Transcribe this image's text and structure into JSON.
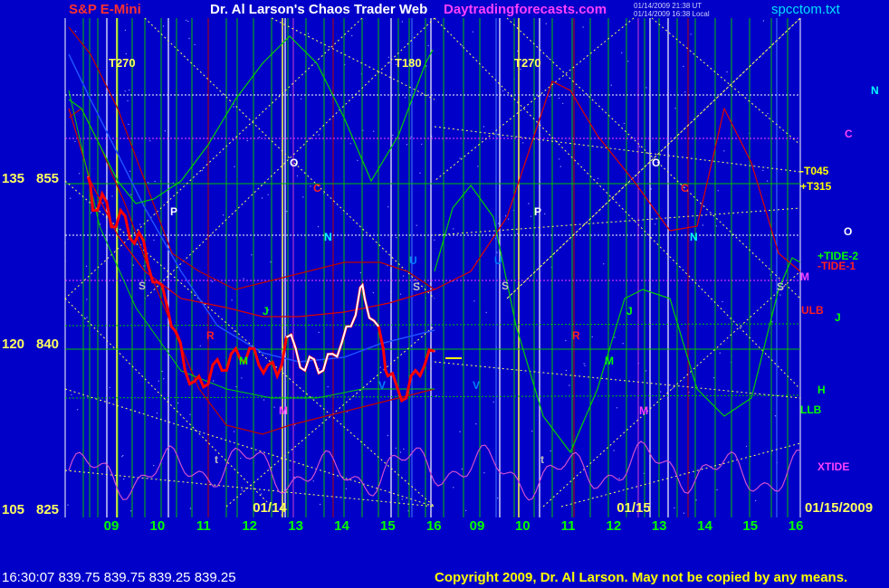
{
  "header": {
    "symbol": "S&P E-Mini",
    "title": "Dr. Al Larson's Chaos Trader Web",
    "site": "Daytradingforecasts.com",
    "stamp1": "01/14/2009 21:38 UT",
    "stamp2": "01/14/2009 16:38 Local",
    "file": "spcctom.txt"
  },
  "footer": {
    "quote": "16:30:07  839.75 839.75 839.25 839.25",
    "copyright": "Copyright 2009, Dr. Al Larson. May not be copied by any means."
  },
  "colors": {
    "background": "#0000c8",
    "green_lines": "#00d000",
    "price_red": "#ff0000",
    "price_white": "#ffffff",
    "grid_yellow": "#ffff60",
    "xtide": "#d050d0"
  },
  "chart_data": {
    "type": "line",
    "y_axis_left": {
      "ticks": [
        {
          "outer": "135",
          "inner": "855",
          "value": 855
        },
        {
          "outer": "120",
          "inner": "840",
          "value": 840
        },
        {
          "outer": "105",
          "inner": "825",
          "value": 825
        }
      ],
      "ylim": [
        825,
        859
      ]
    },
    "x_axis": {
      "hour_labels": [
        "09",
        "10",
        "11",
        "12",
        "13",
        "14",
        "15",
        "16",
        "09",
        "10",
        "11",
        "12",
        "13",
        "14",
        "15",
        "16"
      ],
      "date_labels": [
        "01/14",
        "01/15"
      ],
      "end_date": "01/15/2009"
    },
    "cycle_labels": [
      "T270",
      "T180",
      "T270"
    ],
    "right_labels": [
      {
        "text": "N",
        "color": "#00ffff"
      },
      {
        "text": "C",
        "color": "#ff40ff"
      },
      {
        "text": "-T045",
        "color": "#ffff00"
      },
      {
        "text": "+T315",
        "color": "#ffff00"
      },
      {
        "text": "O",
        "color": "#ffffff"
      },
      {
        "text": "+TIDE-2",
        "color": "#00ff00"
      },
      {
        "text": "-TIDE-1",
        "color": "#ff2020"
      },
      {
        "text": "M",
        "color": "#ff40ff"
      },
      {
        "text": "ULB",
        "color": "#ff2020"
      },
      {
        "text": "J",
        "color": "#00ff00"
      },
      {
        "text": "H",
        "color": "#00ff00"
      },
      {
        "text": "LLB",
        "color": "#00ff00"
      },
      {
        "text": "XTIDE",
        "color": "#ff40ff"
      }
    ],
    "planet_labels": [
      {
        "text": "P",
        "color": "#ffffff"
      },
      {
        "text": "O",
        "color": "#ffffff"
      },
      {
        "text": "C",
        "color": "#ff2020"
      },
      {
        "text": "N",
        "color": "#00ffff"
      },
      {
        "text": "S",
        "color": "#c0c0c0"
      },
      {
        "text": "R",
        "color": "#ff2020"
      },
      {
        "text": "J",
        "color": "#00ff00"
      },
      {
        "text": "M",
        "color": "#00ff00"
      },
      {
        "text": "M",
        "color": "#ff40ff"
      },
      {
        "text": "V",
        "color": "#0080ff"
      },
      {
        "text": "U",
        "color": "#0080ff"
      },
      {
        "text": "S",
        "color": "#c0c0c0"
      },
      {
        "text": "t",
        "color": "#c0c0c0"
      },
      {
        "text": "P",
        "color": "#ffffff"
      },
      {
        "text": "O",
        "color": "#ffffff"
      },
      {
        "text": "C",
        "color": "#ff2020"
      },
      {
        "text": "N",
        "color": "#00ffff"
      },
      {
        "text": "S",
        "color": "#c0c0c0"
      },
      {
        "text": "R",
        "color": "#ff2020"
      },
      {
        "text": "J",
        "color": "#00ff00"
      },
      {
        "text": "M",
        "color": "#00ff00"
      },
      {
        "text": "M",
        "color": "#ff40ff"
      },
      {
        "text": "V",
        "color": "#0080ff"
      },
      {
        "text": "U",
        "color": "#0080ff"
      },
      {
        "text": "S",
        "color": "#c0c0c0"
      },
      {
        "text": "t",
        "color": "#c0c0c0"
      }
    ],
    "price_series": {
      "name": "",
      "x_hours": [
        8.5,
        8.6,
        8.8,
        9.0,
        9.2,
        9.4,
        9.6,
        9.8,
        10.0,
        10.2,
        10.4,
        10.6,
        10.8,
        11.0,
        11.2,
        11.4,
        11.6,
        11.8,
        12.0,
        12.2,
        12.4,
        12.6,
        12.8,
        13.0,
        13.2,
        13.4,
        13.6,
        13.8,
        14.0,
        14.2,
        14.4,
        14.5,
        14.7,
        14.9,
        15.0,
        15.2,
        15.4,
        15.6,
        15.8,
        16.0
      ],
      "values": [
        855,
        852,
        853.5,
        850.5,
        852,
        849.5,
        850,
        847,
        845.5,
        843.5,
        841,
        837.5,
        836.5,
        836,
        838,
        837.5,
        839,
        838.5,
        839.5,
        838,
        838,
        837,
        840.5,
        839.5,
        837.5,
        838.5,
        837.5,
        839,
        840,
        841.5,
        845,
        844,
        842,
        839.5,
        837,
        836,
        835,
        837.5,
        838,
        839.25
      ]
    }
  }
}
